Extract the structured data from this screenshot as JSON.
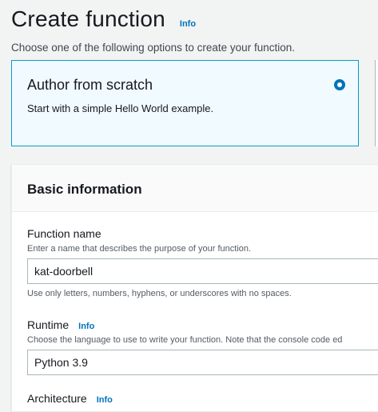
{
  "header": {
    "title": "Create function",
    "info_label": "Info",
    "subtitle": "Choose one of the following options to create your function."
  },
  "options": [
    {
      "title": "Author from scratch",
      "description": "Start with a simple Hello World example.",
      "selected": true
    }
  ],
  "colors": {
    "accent": "#0073bb",
    "selected_card_bg": "#f1faff",
    "selected_card_border": "#00a1c9"
  },
  "basic_info": {
    "title": "Basic information",
    "function_name": {
      "label": "Function name",
      "description": "Enter a name that describes the purpose of your function.",
      "value": "kat-doorbell",
      "hint": "Use only letters, numbers, hyphens, or underscores with no spaces."
    },
    "runtime": {
      "label": "Runtime",
      "info_label": "Info",
      "description": "Choose the language to use to write your function. Note that the console code ed",
      "value": "Python 3.9"
    },
    "architecture": {
      "label": "Architecture",
      "info_label": "Info"
    }
  }
}
